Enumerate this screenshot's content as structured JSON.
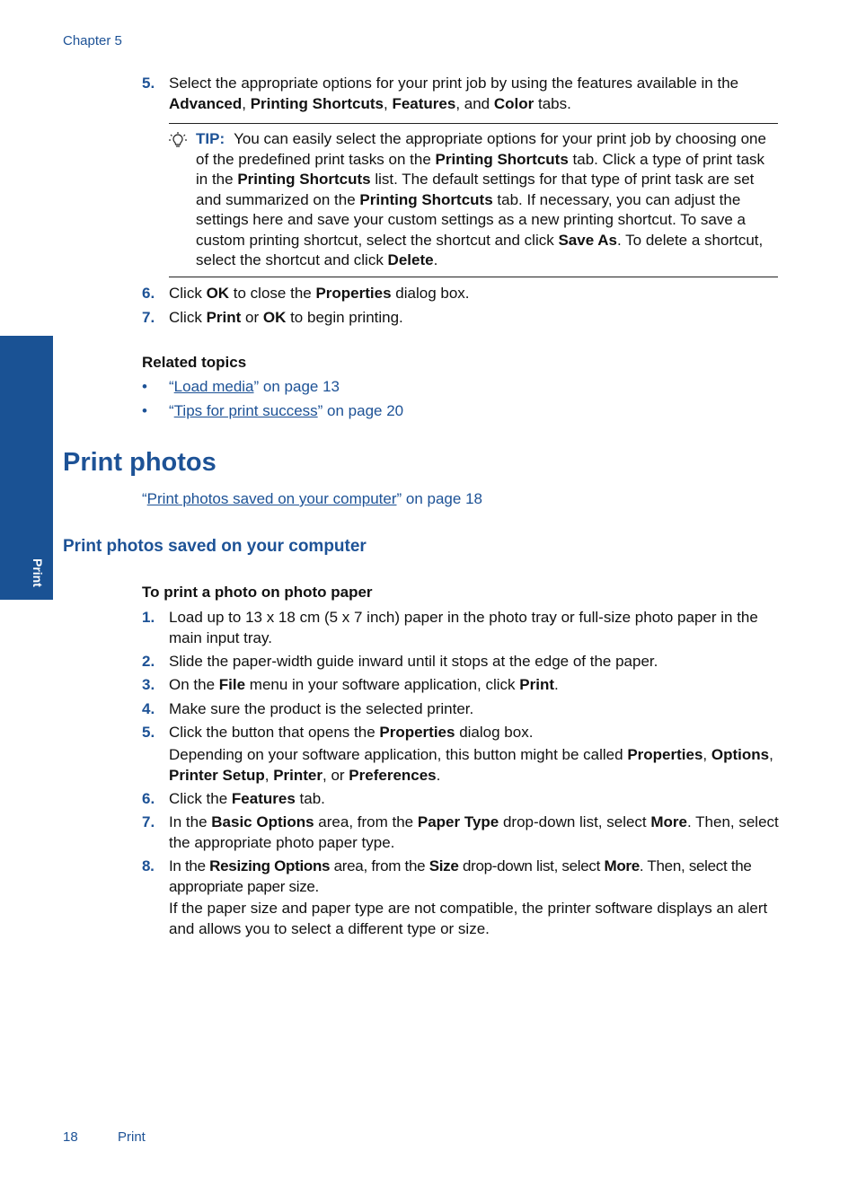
{
  "header": {
    "chapter": "Chapter 5"
  },
  "side_tab": {
    "label": "Print"
  },
  "steps_top": [
    {
      "num": "5.",
      "html": "Select the appropriate options for your print job by using the features available in the <b>Advanced</b>, <b>Printing Shortcuts</b>, <b>Features</b>, and <b>Color</b> tabs."
    },
    {
      "num": "6.",
      "html": "Click <b>OK</b> to close the <b>Properties</b> dialog box."
    },
    {
      "num": "7.",
      "html": "Click <b>Print</b> or <b>OK</b> to begin printing."
    }
  ],
  "tip": {
    "icon": "lightbulb-icon",
    "label": "TIP:",
    "html": "You can easily select the appropriate options for your print job by choosing one of the predefined print tasks on the <b>Printing Shortcuts</b> tab. Click a type of print task in the <b>Printing Shortcuts</b> list. The default settings for that type of print task are set and summarized on the <b>Printing Shortcuts</b> tab. If necessary, you can adjust the settings here and save your custom settings as a new printing shortcut. To save a custom printing shortcut, select the shortcut and click <b>Save As</b>. To delete a shortcut, select the shortcut and click <b>Delete</b>."
  },
  "related": {
    "heading": "Related topics",
    "items": [
      {
        "bullet": "•",
        "link": "Load media",
        "suffix": " on page 13"
      },
      {
        "bullet": "•",
        "link": "Tips for print success",
        "suffix": " on page 20"
      }
    ]
  },
  "section": {
    "title": "Print photos",
    "xref_link": "Print photos saved on your computer",
    "xref_suffix": " on page 18"
  },
  "subsection": {
    "title": "Print photos saved on your computer",
    "procedure_heading": "To print a photo on photo paper",
    "steps": [
      {
        "num": "1.",
        "html": "Load up to 13 x 18 cm (5 x 7 inch) paper in the photo tray or full-size photo paper in the main input tray."
      },
      {
        "num": "2.",
        "html": "Slide the paper-width guide inward until it stops at the edge of the paper."
      },
      {
        "num": "3.",
        "html": "On the <b>File</b> menu in your software application, click <b>Print</b>."
      },
      {
        "num": "4.",
        "html": "Make sure the product is the selected printer."
      },
      {
        "num": "5.",
        "html": "Click the button that opens the <b>Properties</b> dialog box."
      },
      {
        "num": "6.",
        "html": "Click the <b>Features</b> tab."
      },
      {
        "num": "7.",
        "html": "In the <b>Basic Options</b> area, from the <b>Paper Type</b> drop-down list, select <b>More</b>. Then, select the appropriate photo paper type."
      },
      {
        "num": "8.",
        "html": "In the <b>Resizing Options</b> area, from the <b>Size</b> drop-down list, select <b>More</b>. Then, select the appropriate paper size."
      }
    ],
    "note_step5": "Depending on your software application, this button might be called <b>Properties</b>, <b>Options</b>, <b>Printer Setup</b>, <b>Printer</b>, or <b>Preferences</b>.",
    "note_step8": "If the paper size and paper type are not compatible, the printer software displays an alert and allows you to select a different type or size."
  },
  "footer": {
    "page_number": "18",
    "section": "Print"
  }
}
